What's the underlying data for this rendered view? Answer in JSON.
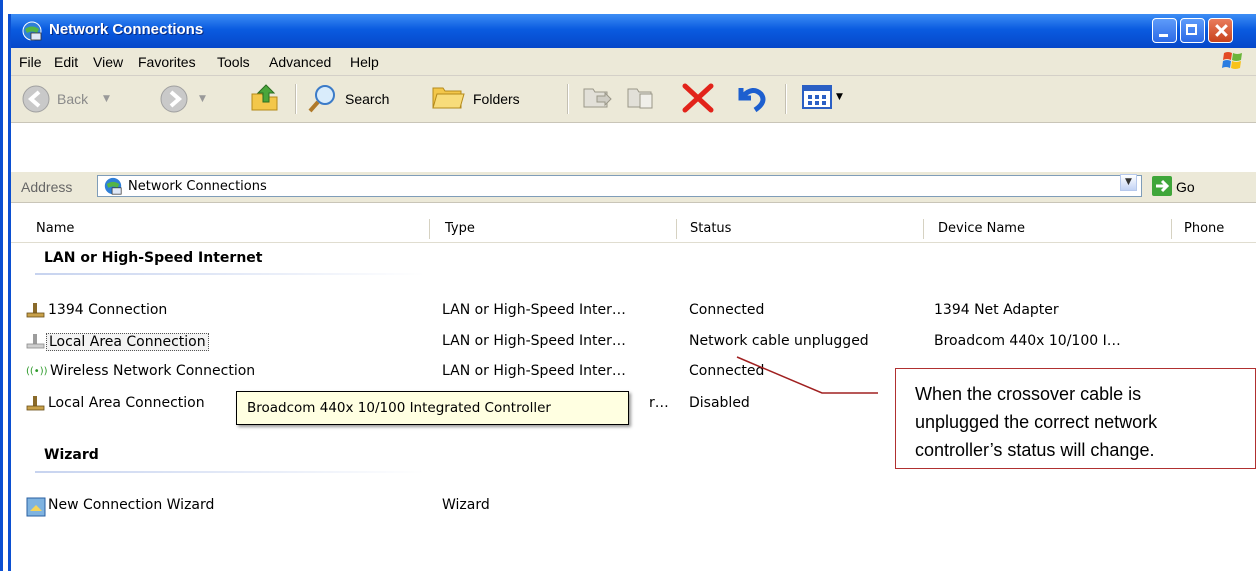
{
  "window": {
    "title": "Network Connections"
  },
  "menu": [
    "File",
    "Edit",
    "View",
    "Favorites",
    "Tools",
    "Advanced",
    "Help"
  ],
  "toolbar": {
    "back_label": "Back",
    "search_label": "Search",
    "folders_label": "Folders"
  },
  "address": {
    "label": "Address",
    "value": "Network Connections",
    "go_label": "Go"
  },
  "columns": [
    "Name",
    "Type",
    "Status",
    "Device Name",
    "Phone"
  ],
  "groups": {
    "lan": "LAN or High-Speed Internet",
    "wizard": "Wizard"
  },
  "rows": [
    {
      "name": "1394 Connection",
      "type": "LAN or High-Speed Inter…",
      "status": "Connected",
      "device": "1394 Net Adapter"
    },
    {
      "name": "Local Area Connection",
      "type": "LAN or High-Speed Inter…",
      "status": "Network cable unplugged",
      "device": "Broadcom 440x 10/100 I…"
    },
    {
      "name": "Wireless Network Connection",
      "type": "LAN or High-Speed Inter…",
      "status": "Connected",
      "device": ""
    },
    {
      "name": "Local Area Connection",
      "type": "r…",
      "status": "Disabled",
      "device": ""
    }
  ],
  "wizard_row": {
    "name": "New Connection Wizard",
    "type": "Wizard"
  },
  "tooltip": "Broadcom 440x 10/100 Integrated Controller",
  "callout": {
    "line1": "When the crossover cable is",
    "line2": "unplugged the correct network",
    "line3": "controller’s status will change."
  },
  "colors": {
    "titlebar": "#0a5be0",
    "chrome": "#ece9d8",
    "callout_border": "#b03030",
    "tooltip_bg": "#ffffe1"
  }
}
